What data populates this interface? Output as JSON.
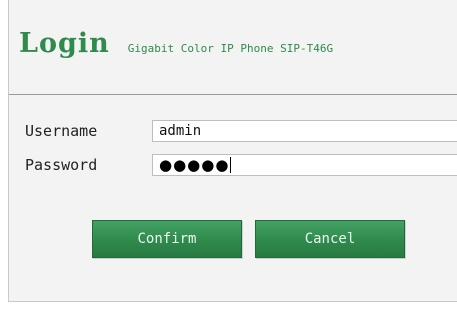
{
  "header": {
    "title": "Login",
    "model": "Gigabit Color IP Phone SIP-T46G"
  },
  "form": {
    "username": {
      "label": "Username",
      "value": "admin"
    },
    "password": {
      "label": "Password",
      "masked_value": "●●●●●"
    }
  },
  "buttons": {
    "confirm_label": "Confirm",
    "cancel_label": "Cancel"
  },
  "colors": {
    "brand_green": "#2f8a4c",
    "panel_background": "#f3f3f3"
  }
}
